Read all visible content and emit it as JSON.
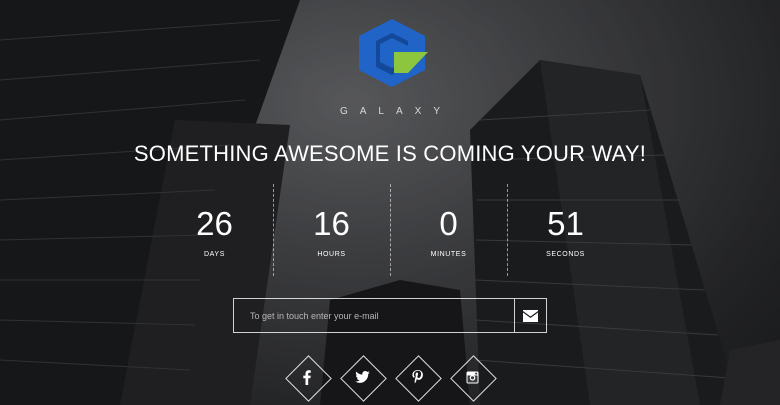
{
  "brand": {
    "name": "GALAXY",
    "logo_icon": "galaxy-g-hexagon-logo",
    "colors": {
      "blue": "#1f64c6",
      "green": "#8cc63f"
    }
  },
  "headline": "SOMETHING AWESOME IS COMING YOUR WAY!",
  "countdown": [
    {
      "value": "26",
      "label": "DAYS"
    },
    {
      "value": "16",
      "label": "HOURS"
    },
    {
      "value": "0",
      "label": "MINUTES"
    },
    {
      "value": "51",
      "label": "SECONDS"
    }
  ],
  "subscribe": {
    "placeholder": "To get in touch enter your e-mail",
    "button_icon": "envelope-icon"
  },
  "social": [
    {
      "name": "facebook",
      "icon": "facebook-icon"
    },
    {
      "name": "twitter",
      "icon": "twitter-icon"
    },
    {
      "name": "pinterest",
      "icon": "pinterest-icon"
    },
    {
      "name": "instagram",
      "icon": "instagram-icon"
    }
  ]
}
